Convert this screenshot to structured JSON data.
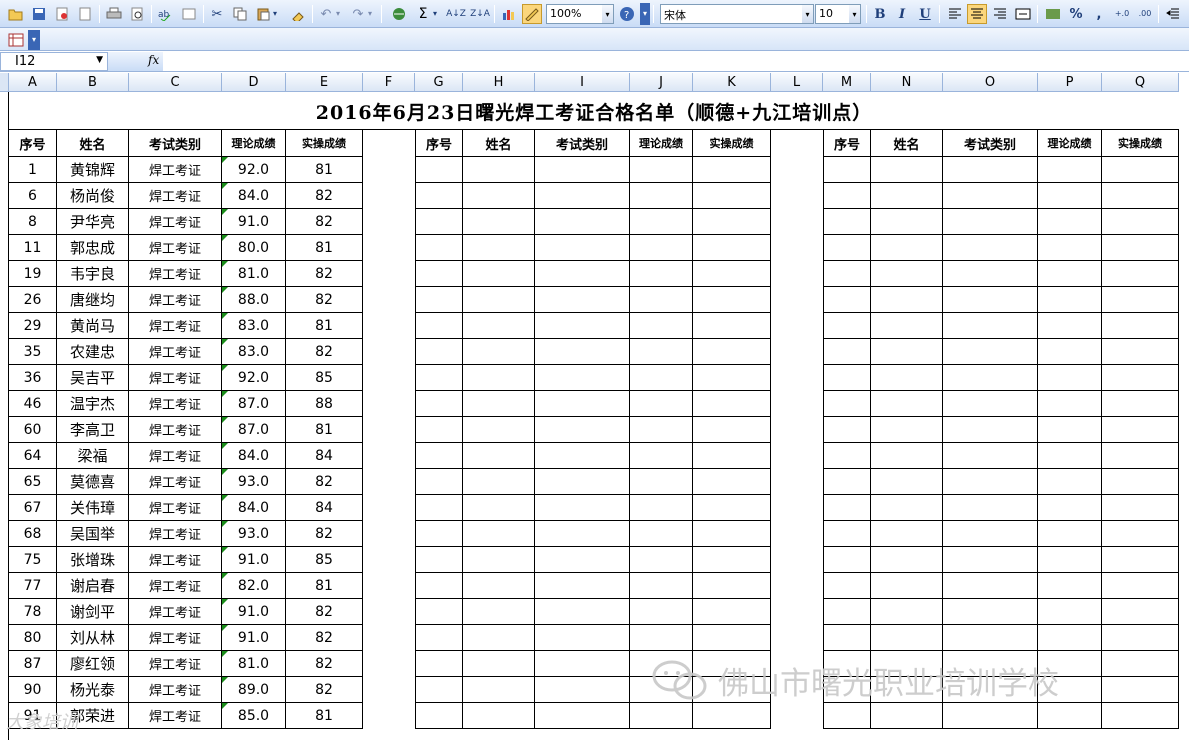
{
  "toolbar": {
    "zoom": "100%",
    "font_name": "宋体",
    "font_size": "10",
    "bold_label": "B",
    "italic_label": "I",
    "underline_label": "U",
    "percent_label": "%",
    "comma_label": ",",
    "sum_label": "Σ"
  },
  "formula_bar": {
    "name_box": "I12",
    "fx_label": "fx",
    "formula": ""
  },
  "columns": [
    "A",
    "B",
    "C",
    "D",
    "E",
    "F",
    "G",
    "H",
    "I",
    "J",
    "K",
    "L",
    "M",
    "N",
    "O",
    "P",
    "Q"
  ],
  "sheet_title": "2016年6月23日曙光焊工考证合格名单（顺德+九江培训点）",
  "table_headers": [
    "序号",
    "姓名",
    "考试类别",
    "理论成绩",
    "实操成绩"
  ],
  "rows": [
    {
      "no": "1",
      "name": "黄锦辉",
      "type": "焊工考证",
      "theory": "92.0",
      "practice": "81"
    },
    {
      "no": "6",
      "name": "杨尚俊",
      "type": "焊工考证",
      "theory": "84.0",
      "practice": "82"
    },
    {
      "no": "8",
      "name": "尹华亮",
      "type": "焊工考证",
      "theory": "91.0",
      "practice": "82"
    },
    {
      "no": "11",
      "name": "郭忠成",
      "type": "焊工考证",
      "theory": "80.0",
      "practice": "81"
    },
    {
      "no": "19",
      "name": "韦宇良",
      "type": "焊工考证",
      "theory": "81.0",
      "practice": "82"
    },
    {
      "no": "26",
      "name": "唐继均",
      "type": "焊工考证",
      "theory": "88.0",
      "practice": "82"
    },
    {
      "no": "29",
      "name": "黄尚马",
      "type": "焊工考证",
      "theory": "83.0",
      "practice": "81"
    },
    {
      "no": "35",
      "name": "农建忠",
      "type": "焊工考证",
      "theory": "83.0",
      "practice": "82"
    },
    {
      "no": "36",
      "name": "吴吉平",
      "type": "焊工考证",
      "theory": "92.0",
      "practice": "85"
    },
    {
      "no": "46",
      "name": "温宇杰",
      "type": "焊工考证",
      "theory": "87.0",
      "practice": "88"
    },
    {
      "no": "60",
      "name": "李高卫",
      "type": "焊工考证",
      "theory": "87.0",
      "practice": "81"
    },
    {
      "no": "64",
      "name": "梁福",
      "type": "焊工考证",
      "theory": "84.0",
      "practice": "84"
    },
    {
      "no": "65",
      "name": "莫德喜",
      "type": "焊工考证",
      "theory": "93.0",
      "practice": "82"
    },
    {
      "no": "67",
      "name": "关伟璋",
      "type": "焊工考证",
      "theory": "84.0",
      "practice": "84"
    },
    {
      "no": "68",
      "name": "吴国举",
      "type": "焊工考证",
      "theory": "93.0",
      "practice": "82"
    },
    {
      "no": "75",
      "name": "张增珠",
      "type": "焊工考证",
      "theory": "91.0",
      "practice": "85"
    },
    {
      "no": "77",
      "name": "谢启春",
      "type": "焊工考证",
      "theory": "82.0",
      "practice": "81"
    },
    {
      "no": "78",
      "name": "谢剑平",
      "type": "焊工考证",
      "theory": "91.0",
      "practice": "82"
    },
    {
      "no": "80",
      "name": "刘从林",
      "type": "焊工考证",
      "theory": "91.0",
      "practice": "82"
    },
    {
      "no": "87",
      "name": "廖红领",
      "type": "焊工考证",
      "theory": "81.0",
      "practice": "82"
    },
    {
      "no": "90",
      "name": "杨光泰",
      "type": "焊工考证",
      "theory": "89.0",
      "practice": "82"
    },
    {
      "no": "91",
      "name": "郭荣进",
      "type": "焊工考证",
      "theory": "85.0",
      "practice": "81"
    }
  ],
  "watermark": "佛山市曙光职业培训学校",
  "watermark_small": "大象培训"
}
